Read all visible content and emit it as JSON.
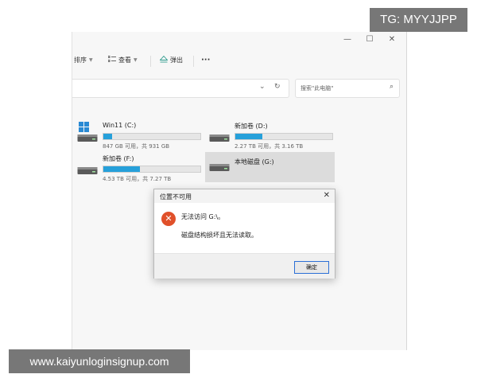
{
  "window_controls": {
    "minimize": "—",
    "maximize": "☐",
    "close": "✕"
  },
  "toolbar": {
    "sort_label": "排序",
    "view_label": "查看",
    "eject_label": "弹出",
    "more_label": "···"
  },
  "address": {
    "dropdown": "⌄",
    "refresh": "↻"
  },
  "search": {
    "placeholder": "搜索\"此电脑\""
  },
  "drives": [
    {
      "name": "Win11 (C:)",
      "size_text": "847 GB 可用，共 931 GB",
      "used_fraction": 0.09
    },
    {
      "name": "新加卷 (D:)",
      "size_text": "2.27 TB 可用，共 3.16 TB",
      "used_fraction": 0.28
    },
    {
      "name": "新加卷 (F:)",
      "size_text": "4.53 TB 可用，共 7.27 TB",
      "used_fraction": 0.38
    },
    {
      "name": "本地磁盘 (G:)"
    }
  ],
  "dialog": {
    "title": "位置不可用",
    "close": "✕",
    "message_line1": "无法访问 G:\\。",
    "message_line2": "磁盘结构损坏且无法读取。",
    "ok_label": "确定"
  },
  "overlays": {
    "tg_badge": "TG: MYYJJPP",
    "site_badge": "www.kaiyunloginsignup.com"
  },
  "colors": {
    "accent": "#26a0da",
    "error": "#e0502a",
    "button_border": "#2b6fd6"
  }
}
